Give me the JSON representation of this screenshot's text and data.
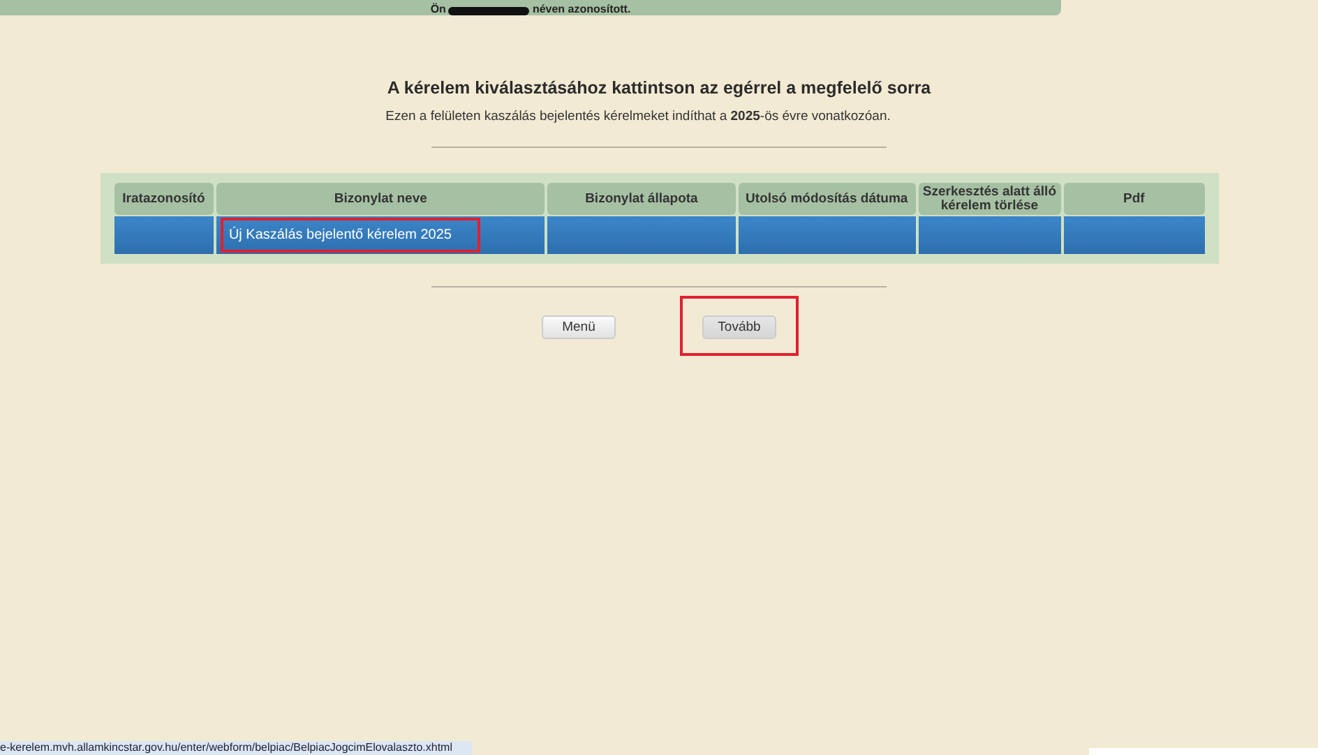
{
  "top_bar": {
    "text_before": "Ön",
    "text_after": "néven azonosított."
  },
  "heading": "A kérelem kiválasztásához kattintson az egérrel a megfelelő sorra",
  "intro": "Ezen a felületen kaszálás bejelentés kérelmeket indíthat a **2025**-ös évre vonatkozóan.",
  "table": {
    "columns": [
      "Iratazonosító",
      "Bizonylat neve",
      "Bizonylat állapota",
      "Utolsó módosítás dátuma",
      "Szerkesztés alatt álló kérelem törlése",
      "Pdf"
    ],
    "rows": [
      {
        "selected": true,
        "name_highlighted": true,
        "cells": [
          "",
          "Új Kaszálás bejelentő kérelem 2025",
          "",
          "",
          "",
          ""
        ]
      }
    ]
  },
  "buttons": [
    {
      "label": "Menü",
      "highlighted": false
    },
    {
      "label": "Tovább",
      "highlighted": true
    }
  ],
  "status_url": "e-kerelem.mvh.allamkincstar.gov.hu/enter/webform/belpiac/BelpiacJogcimElovalaszto.xhtml"
}
